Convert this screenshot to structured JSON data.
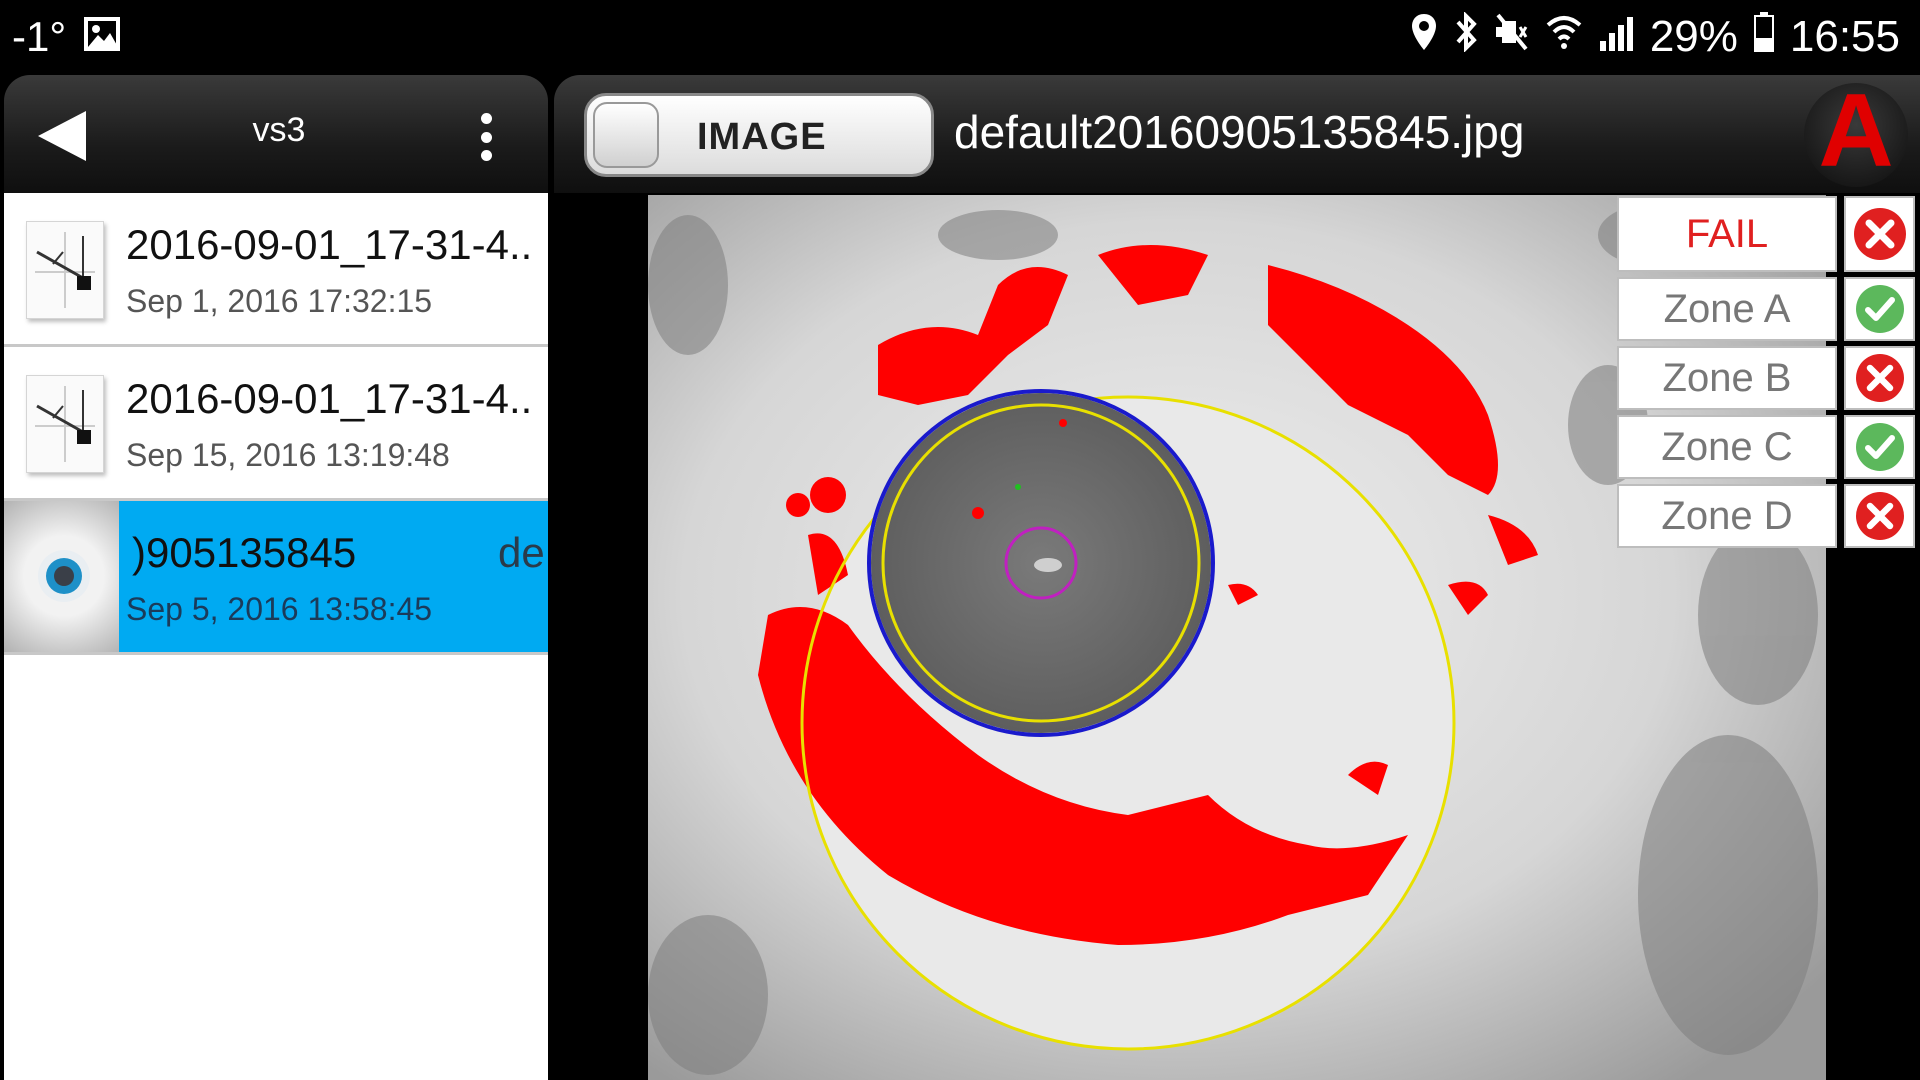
{
  "status_bar": {
    "temperature": "-1°",
    "battery": "29%",
    "time": "16:55",
    "icons": [
      "image-icon",
      "location-icon",
      "bluetooth-icon",
      "mute-icon",
      "wifi-icon",
      "signal-icon",
      "battery-icon"
    ]
  },
  "left_panel": {
    "title": "vs3",
    "files": [
      {
        "name": "2016-09-01_17-31-4..",
        "date": "Sep 1, 2016 17:32:15",
        "thumb": "chart-file-icon",
        "selected": false
      },
      {
        "name": "2016-09-01_17-31-4..",
        "date": "Sep 15, 2016 13:19:48",
        "thumb": "chart-file-icon",
        "selected": false
      },
      {
        "name": ")905135845",
        "extra": "de",
        "date": "Sep 5, 2016 13:58:45",
        "thumb": "fiber-image-thumbnail",
        "selected": true
      }
    ]
  },
  "right_panel": {
    "toggle_label": "IMAGE",
    "file_title": "default20160905135845.jpg",
    "logo_letter": "A"
  },
  "results": {
    "overall": {
      "label": "FAIL",
      "status": "fail"
    },
    "zones": [
      {
        "label": "Zone A",
        "status": "pass"
      },
      {
        "label": "Zone B",
        "status": "fail"
      },
      {
        "label": "Zone C",
        "status": "pass"
      },
      {
        "label": "Zone D",
        "status": "fail"
      }
    ]
  },
  "colors": {
    "selected_row": "#00aaf2",
    "fail_red": "#e02020",
    "pass_green": "#5cb85c",
    "defect_red": "#ff0000",
    "ring_yellow": "#e8e000",
    "ring_blue": "#1a1acc",
    "ring_magenta": "#c020c0"
  }
}
